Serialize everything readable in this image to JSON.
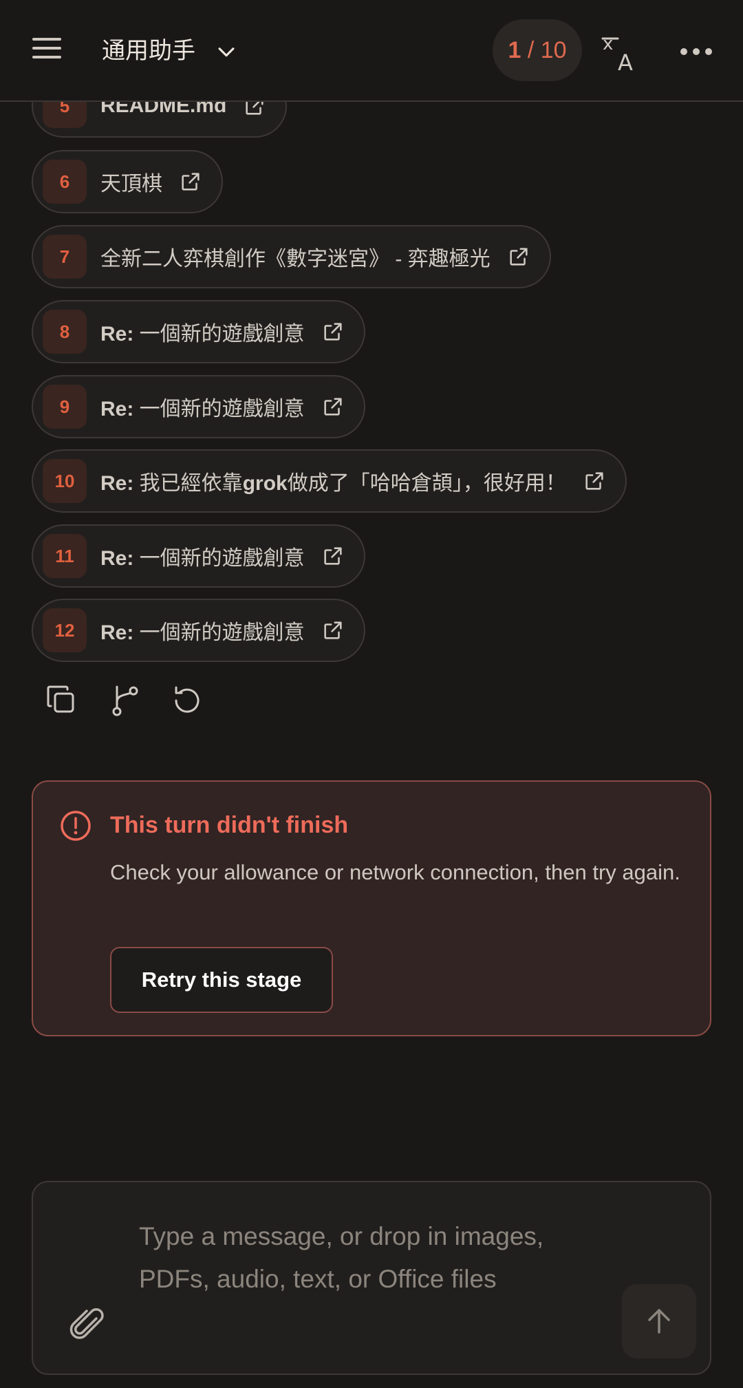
{
  "header": {
    "title": "通用助手",
    "counter": {
      "current": "1",
      "separator": " / ",
      "total": "10"
    }
  },
  "sources": [
    {
      "num": "5",
      "prefix": "",
      "text": "README.md",
      "bold_inline": ""
    },
    {
      "num": "6",
      "prefix": "",
      "text": "天頂棋",
      "bold_inline": ""
    },
    {
      "num": "7",
      "prefix": "",
      "text": "全新二人弈棋創作《數字迷宮》 - 弈趣極光",
      "bold_inline": ""
    },
    {
      "num": "8",
      "prefix": "Re:",
      "text": " 一個新的遊戲創意",
      "bold_inline": ""
    },
    {
      "num": "9",
      "prefix": "Re:",
      "text": " 一個新的遊戲創意",
      "bold_inline": ""
    },
    {
      "num": "10",
      "prefix": "Re:",
      "text_before": " 我已經依靠",
      "bold_inline": "grok",
      "text_after": "做成了「哈哈倉頡」，很好用！"
    },
    {
      "num": "11",
      "prefix": "Re:",
      "text": " 一個新的遊戲創意",
      "bold_inline": ""
    },
    {
      "num": "12",
      "prefix": "Re:",
      "text": " 一個新的遊戲創意",
      "bold_inline": ""
    }
  ],
  "error": {
    "title": "This turn didn't finish",
    "message": "Check your allowance or network connection, then try again.",
    "retry_label": "Retry this stage"
  },
  "composer": {
    "placeholder": "Type a message, or drop in images, PDFs, audio, text, or Office files"
  },
  "icons": {
    "menu": "hamburger-icon",
    "chevron": "chevron-down-icon",
    "translate": "translate-icon",
    "more": "more-horizontal-icon",
    "external": "external-link-icon",
    "copy": "copy-icon",
    "branch": "branch-icon",
    "regenerate": "regenerate-icon",
    "alert": "alert-circle-icon",
    "attach": "paperclip-icon",
    "send": "arrow-up-icon"
  },
  "colors": {
    "accent": "#e06a4f",
    "error": "#ee6b5a",
    "background": "#1a1817"
  }
}
